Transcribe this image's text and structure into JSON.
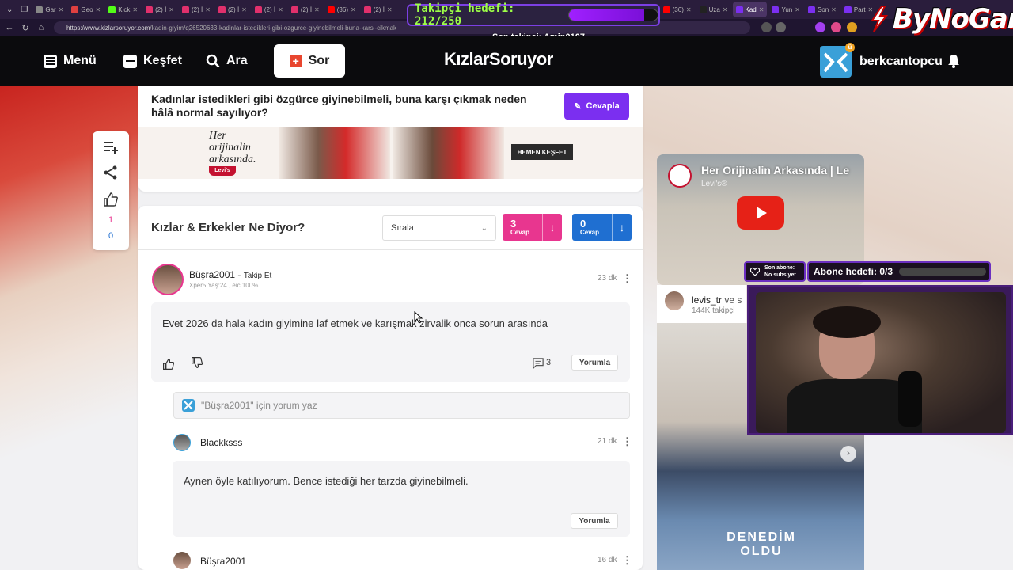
{
  "browser": {
    "tabs": [
      {
        "label": "Gar",
        "color": "#888888"
      },
      {
        "label": "Geo",
        "color": "#e04040"
      },
      {
        "label": "Kick",
        "color": "#53fc18"
      },
      {
        "label": "(2) İ",
        "color": "#e1306c"
      },
      {
        "label": "(2) İ",
        "color": "#e1306c"
      },
      {
        "label": "(2) İ",
        "color": "#e1306c"
      },
      {
        "label": "(2) İ",
        "color": "#e1306c"
      },
      {
        "label": "(2) İ",
        "color": "#e1306c"
      },
      {
        "label": "(36)",
        "color": "#ff0000"
      },
      {
        "label": "(2) İ",
        "color": "#e1306c"
      }
    ],
    "tabs_right": [
      {
        "label": "(36)",
        "color": "#ff0000"
      },
      {
        "label": "Uza",
        "color": "#222222"
      },
      {
        "label": "Kad",
        "color": "#7b2ff0",
        "active": true
      },
      {
        "label": "Yun",
        "color": "#7b2ff0"
      },
      {
        "label": "Son",
        "color": "#7b2ff0"
      },
      {
        "label": "Part",
        "color": "#7b2ff0"
      }
    ],
    "url_host": "https://www.kizlarsoruyor.com",
    "url_path": "/kadin-giyim/q26520633-kadinlar-istedikleri-gibi-ozgurce-giyinebilmeli-buna-karsi-cikmak"
  },
  "stream": {
    "follower_goal_label": "Takipçi hedefi: 212/250",
    "follower_goal_progress": 0.848,
    "last_follower": "Son takipçi: Amin0107",
    "brand": "ByNoGame",
    "last_sub_label": "Son abone:",
    "last_sub_value": "No subs yet",
    "sub_goal_label": "Abone hedefi: 0/3",
    "sub_goal_progress": 0
  },
  "header": {
    "menu_label": "Menü",
    "explore_label": "Keşfet",
    "search_label": "Ara",
    "ask_label": "Sor",
    "logo_text": "KızlarSoruyor",
    "username": "berkcantopcu"
  },
  "question": {
    "title": "Kadınlar istedikleri gibi özgürce giyinebilmeli, buna karşı çıkmak neden hâlâ normal sayılıyor?",
    "answer_button": "Cevapla"
  },
  "ad": {
    "line1": "Her",
    "line2": "orijinalin",
    "line3": "arkasında.",
    "brand": "Levi's",
    "cta": "HEMEN KEŞFET"
  },
  "floatbar": {
    "likes": "1",
    "dislikes": "0"
  },
  "answers": {
    "title": "Kızlar & Erkekler Ne Diyor?",
    "sort_label": "Sırala",
    "girls_count": "3",
    "girls_label": "Cevap",
    "boys_count": "0",
    "boys_label": "Cevap",
    "colors": {
      "girls": "#e8368f",
      "boys": "#1f6fd1"
    }
  },
  "post": {
    "username": "Büşra2001",
    "follow": "Takip Et",
    "meta": "Xper5 Yaş:24 , eic 100%",
    "time": "23 dk",
    "text": "Evet 2026 da hala kadın giyimine laf etmek ve karışmak zirvalik onca sorun arasında",
    "comment_count": "3",
    "comment_button": "Yorumla",
    "comment_placeholder": "\"Büşra2001\" için yorum yaz"
  },
  "reply1": {
    "username": "Blackksss",
    "time": "21 dk",
    "text": "Aynen öyle katılıyorum. Bence istediği her tarzda giyinebilmeli.",
    "comment_button": "Yorumla"
  },
  "reply2": {
    "username": "Büşra2001",
    "time": "16 dk"
  },
  "sidebar": {
    "video_title": "Her Orijinalin Arkasında | Le",
    "video_channel": "Levi's®",
    "levis_name_a": "levis_tr",
    "levis_name_b": "ve s",
    "levis_followers": "144K takipçi",
    "promo_text": "DENEDİM OLDU"
  }
}
